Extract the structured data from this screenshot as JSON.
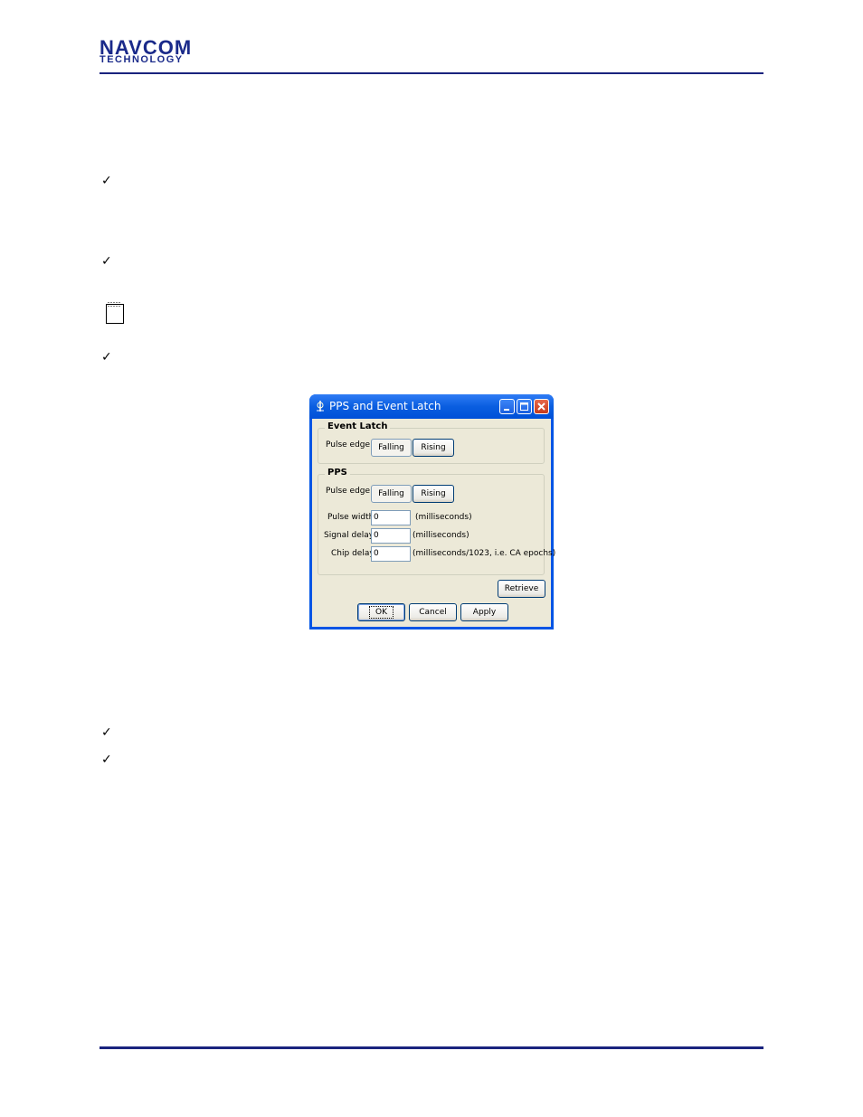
{
  "header": {
    "logo_line1": "NAVCOM",
    "logo_line2": "TECHNOLOGY"
  },
  "bullets": {
    "mark": "✓"
  },
  "icons": {
    "note": "notepad-icon"
  },
  "dialog": {
    "title": "PPS and Event Latch",
    "event_latch": {
      "group_title": "Event Latch",
      "pulse_edge_label": "Pulse edge:",
      "falling_label": "Falling",
      "rising_label": "Rising",
      "selected": "Falling"
    },
    "pps": {
      "group_title": "PPS",
      "pulse_edge_label": "Pulse edge:",
      "falling_label": "Falling",
      "rising_label": "Rising",
      "selected": "Falling",
      "pulse_width_label": "Pulse width",
      "pulse_width_value": "0",
      "pulse_width_unit": "(milliseconds)",
      "signal_delay_label": "Signal delay:",
      "signal_delay_value": "0",
      "signal_delay_unit": "(milliseconds)",
      "chip_delay_label": "Chip delay:",
      "chip_delay_value": "0",
      "chip_delay_unit": "(milliseconds/1023, i.e. CA epochs)"
    },
    "buttons": {
      "retrieve": "Retrieve",
      "ok": "OK",
      "cancel": "Cancel",
      "apply": "Apply"
    }
  },
  "colors": {
    "rule": "#1a237e",
    "titlebar": "#0a5ee0",
    "dialog_bg": "#ece9d8"
  }
}
